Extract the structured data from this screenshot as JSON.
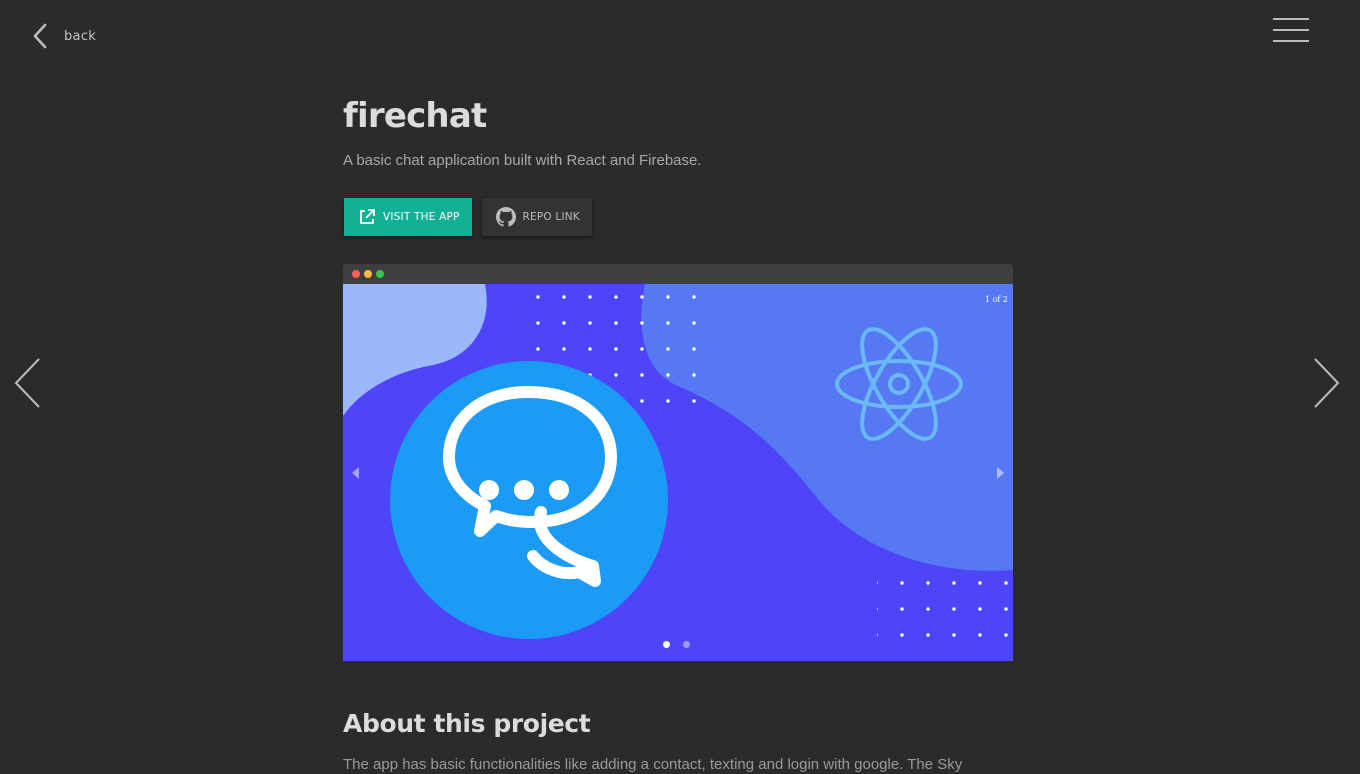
{
  "nav": {
    "back_label": "back"
  },
  "project": {
    "title": "firechat",
    "description": "A basic chat application built with React and Firebase.",
    "visit_label": "VISIT THE APP",
    "repo_label": "REPO LINK"
  },
  "carousel": {
    "counter": "1 of 2",
    "current_slide": 1,
    "total_slides": 2
  },
  "about": {
    "heading": "About this project",
    "text": "The app has basic functionalities like adding a contact, texting and login with google. The Sky"
  },
  "colors": {
    "background": "#2b2b2b",
    "accent": "#12b195",
    "slide_background": "#4e44f8"
  }
}
